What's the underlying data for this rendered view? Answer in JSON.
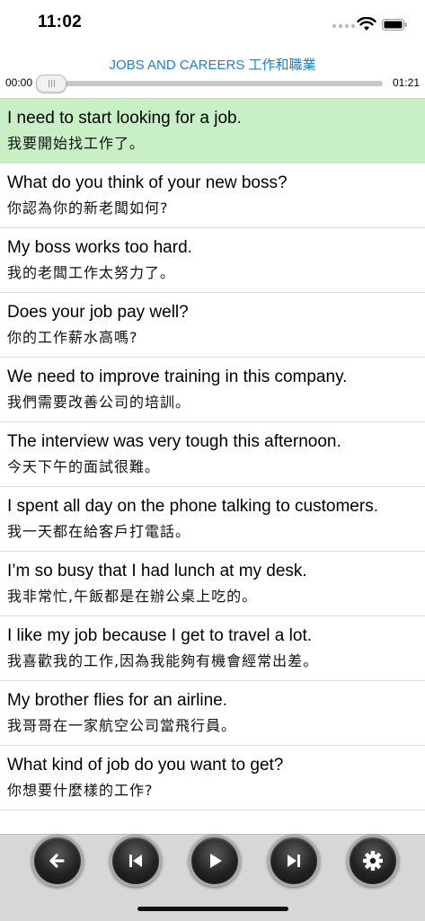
{
  "status": {
    "time": "11:02"
  },
  "nav": {
    "title": "JOBS AND CAREERS 工作和職業"
  },
  "player": {
    "current_time": "00:00",
    "total_time": "01:21",
    "progress": 0.0
  },
  "phrases": [
    {
      "en": "I need to start looking for a job.",
      "zh": "我要開始找工作了。",
      "selected": true
    },
    {
      "en": "What do you think of your new boss?",
      "zh": "你認為你的新老闆如何?",
      "selected": false
    },
    {
      "en": "My boss works too hard.",
      "zh": "我的老闆工作太努力了。",
      "selected": false
    },
    {
      "en": "Does your job pay well?",
      "zh": "你的工作薪水高嗎?",
      "selected": false
    },
    {
      "en": "We need to improve training in this company.",
      "zh": "我們需要改善公司的培訓。",
      "selected": false
    },
    {
      "en": "The interview was very tough this afternoon.",
      "zh": "今天下午的面試很難。",
      "selected": false
    },
    {
      "en": "I spent all day on the phone talking to customers.",
      "zh": "我一天都在給客戶打電話。",
      "selected": false
    },
    {
      "en": "I’m so busy that I had lunch at my desk.",
      "zh": "我非常忙,午飯都是在辦公桌上吃的。",
      "selected": false
    },
    {
      "en": "I like my job because I get to travel a lot.",
      "zh": "我喜歡我的工作,因為我能夠有機會經常出差。",
      "selected": false
    },
    {
      "en": "My brother flies for an airline.",
      "zh": "我哥哥在一家航空公司當飛行員。",
      "selected": false
    },
    {
      "en": "What kind of job do you want to get?",
      "zh": "你想要什麼樣的工作?",
      "selected": false
    }
  ],
  "toolbar": {
    "buttons": [
      {
        "icon": "back-arrow-icon"
      },
      {
        "icon": "previous-track-icon"
      },
      {
        "icon": "play-icon"
      },
      {
        "icon": "next-track-icon"
      },
      {
        "icon": "gear-icon"
      }
    ]
  },
  "colors": {
    "accent": "#1b7fd6",
    "selected_row": "#c9efc7",
    "toolbar_bg": "#d7d7d7"
  }
}
